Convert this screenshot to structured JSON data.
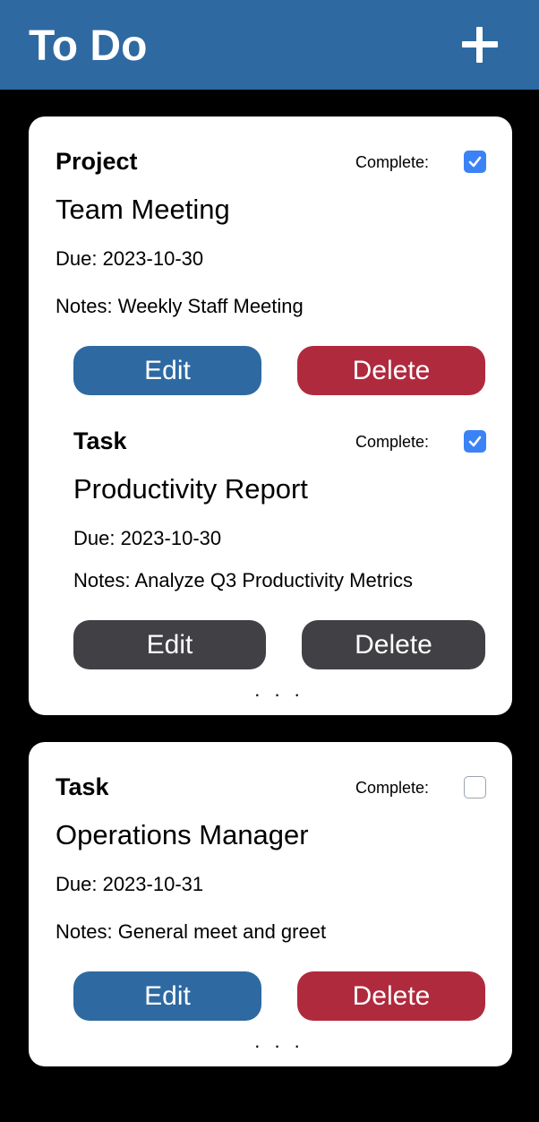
{
  "header": {
    "title": "To Do",
    "add_icon": "plus-icon",
    "color": "#2e69a2"
  },
  "items": [
    {
      "type": "Project",
      "complete_label": "Complete:",
      "complete": true,
      "title": "Team Meeting",
      "due": "Due: 2023-10-30",
      "notes": "Notes: Weekly Staff Meeting",
      "edit_label": "Edit",
      "delete_label": "Delete",
      "subtask": {
        "type": "Task",
        "complete_label": "Complete:",
        "complete": true,
        "title": "Productivity Report",
        "due": "Due: 2023-10-30",
        "notes": "Notes: Analyze Q3 Productivity Metrics",
        "edit_label": "Edit",
        "delete_label": "Delete"
      },
      "more_label": ". . ."
    },
    {
      "type": "Task",
      "complete_label": "Complete:",
      "complete": false,
      "title": "Operations Manager",
      "due": "Due: 2023-10-31",
      "notes": "Notes: General meet and greet",
      "edit_label": "Edit",
      "delete_label": "Delete",
      "more_label": ". . ."
    }
  ],
  "colors": {
    "primary": "#2e69a2",
    "danger": "#b02a3e",
    "neutral": "#404045",
    "checkbox": "#3b82f6"
  }
}
